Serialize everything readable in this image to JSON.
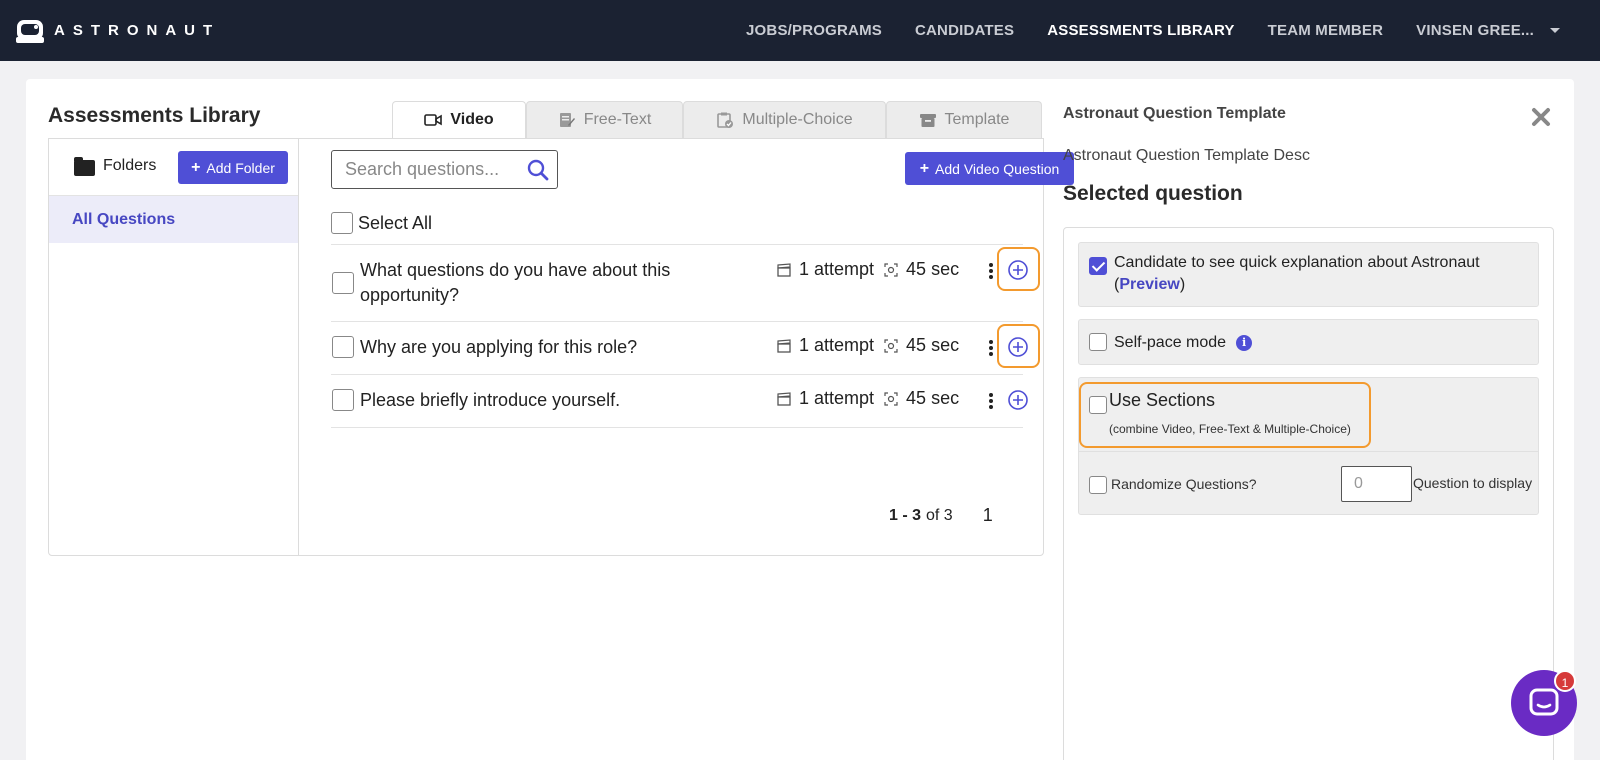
{
  "app": {
    "logo_text": "ASTRONAUT"
  },
  "nav": {
    "items": [
      "JOBS/PROGRAMS",
      "CANDIDATES",
      "ASSESSMENTS LIBRARY",
      "TEAM MEMBER"
    ],
    "active": "ASSESSMENTS LIBRARY",
    "user": "VINSEN GREE..."
  },
  "library": {
    "title": "Assessments Library",
    "tabs": [
      "Video",
      "Free-Text",
      "Multiple-Choice",
      "Template"
    ],
    "active_tab": "Video",
    "folders_label": "Folders",
    "add_folder_label": "Add Folder",
    "all_questions_label": "All Questions",
    "search_placeholder": "Search questions...",
    "add_video_label": "Add Video Question",
    "select_all_label": "Select All",
    "questions": [
      {
        "text": "What questions do you have about this opportunity?",
        "attempts": "1 attempt",
        "time": "45 sec"
      },
      {
        "text": "Why are you applying for this role?",
        "attempts": "1 attempt",
        "time": "45 sec"
      },
      {
        "text": "Please briefly introduce yourself.",
        "attempts": "1 attempt",
        "time": "45 sec"
      }
    ],
    "pager": {
      "range": "1 - 3",
      "of_text": "of 3",
      "page": "1"
    }
  },
  "template": {
    "title": "Astronaut Question Template",
    "description": "Astronaut Question Template Desc",
    "selected_title": "Selected question",
    "options": {
      "explanation_text": "Candidate to see quick explanation about Astronaut (",
      "explanation_link": "Preview",
      "explanation_close": ")",
      "explanation_checked": true,
      "self_pace_label": "Self-pace mode",
      "self_pace_checked": false,
      "use_sections_label": "Use Sections",
      "use_sections_sub": "(combine Video, Free-Text & Multiple-Choice)",
      "use_sections_checked": false,
      "randomize_label": "Randomize Questions?",
      "randomize_checked": false,
      "question_count_value": "0",
      "question_to_display_label": "Question to display"
    }
  },
  "chat": {
    "badge": "1"
  },
  "colors": {
    "accent": "#4f4fd6",
    "highlight": "#f39a2e",
    "nav_bg": "#1b2232",
    "chat": "#6a2bc4"
  }
}
